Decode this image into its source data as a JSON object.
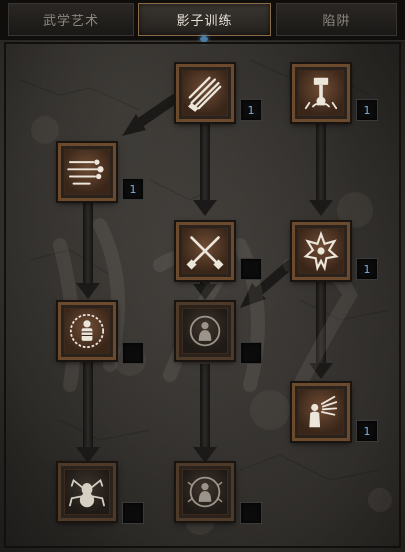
{
  "tabs": [
    {
      "label": "武学艺术",
      "active": false
    },
    {
      "label": "影子训练",
      "active": true
    },
    {
      "label": "陷阱",
      "active": false
    }
  ],
  "colors": {
    "tab_active_border": "#8a6b48",
    "rank_text": "#7fb0e0",
    "skill_border": "#6b4a2e",
    "icon_light": "#e8e2d8"
  },
  "skills": [
    {
      "id": "claw-mastery",
      "icon": "claw-icon",
      "rank": "1",
      "learned": true
    },
    {
      "id": "psychic-hammer",
      "icon": "hammer-icon",
      "rank": "1",
      "learned": true
    },
    {
      "id": "burst-of-speed",
      "icon": "speed-icon",
      "rank": "1",
      "learned": true
    },
    {
      "id": "weapon-block",
      "icon": "crossed-blades-icon",
      "rank": "",
      "learned": false
    },
    {
      "id": "cloak-of-shadows",
      "icon": "starburst-icon",
      "rank": "1",
      "learned": true
    },
    {
      "id": "fade",
      "icon": "aura-figure-icon",
      "rank": "",
      "learned": false
    },
    {
      "id": "shadow-warrior",
      "icon": "dark-figure-icon",
      "rank": "",
      "learned": false
    },
    {
      "id": "mind-blast",
      "icon": "blast-figure-icon",
      "rank": "1",
      "learned": true
    },
    {
      "id": "venom",
      "icon": "spider-icon",
      "rank": "",
      "learned": false
    },
    {
      "id": "shadow-master",
      "icon": "shadow-master-icon",
      "rank": "",
      "learned": false
    }
  ]
}
